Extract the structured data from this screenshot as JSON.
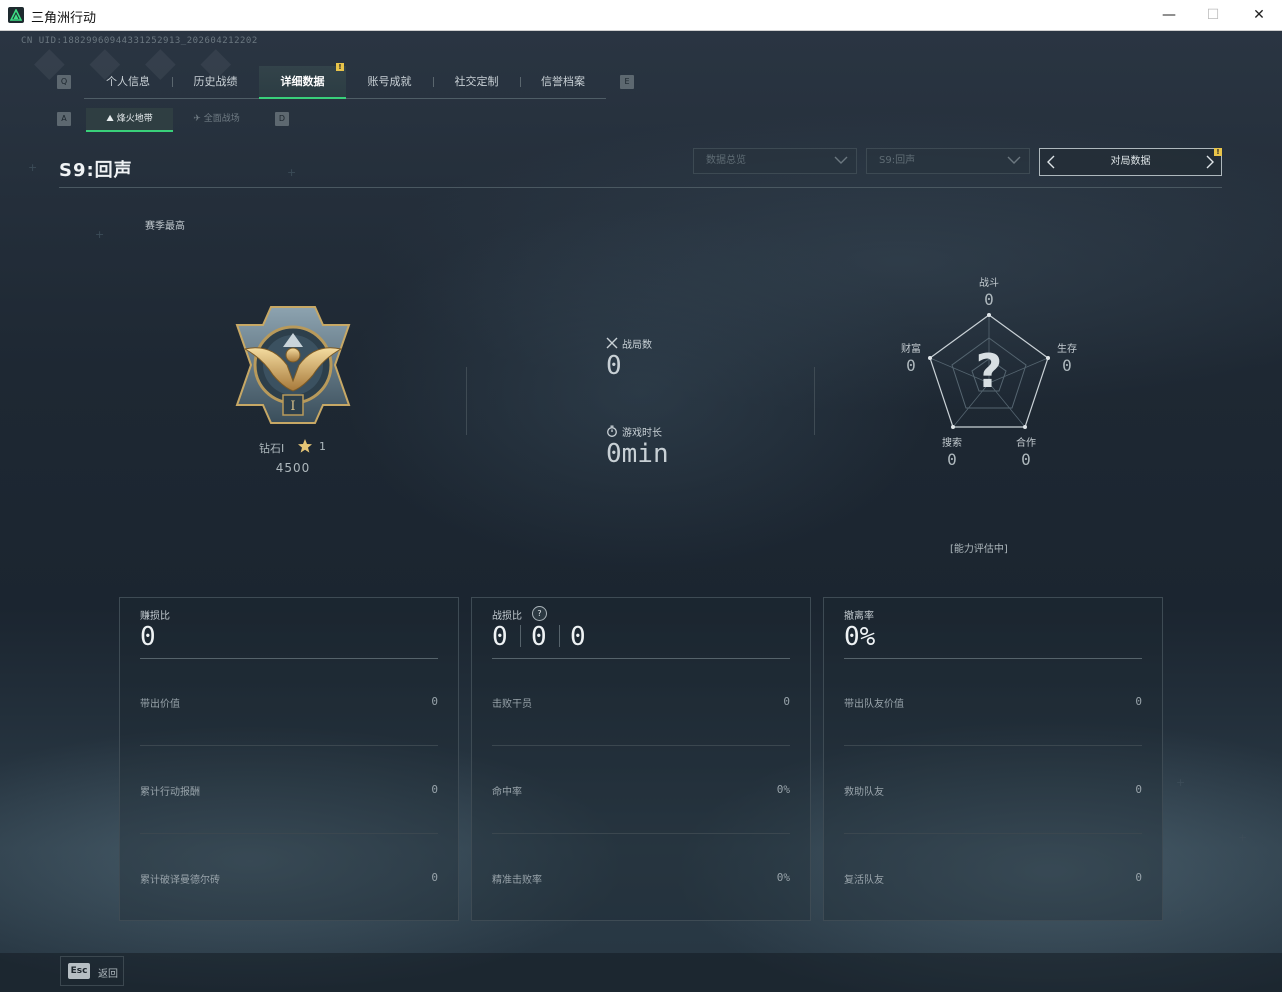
{
  "window": {
    "title": "三角洲行动",
    "controls": {
      "minimize": "—",
      "maximize": "☐",
      "close": "✕"
    }
  },
  "header": {
    "uid": "CN UID:18829960944331252913_202604212202",
    "tabs_key_left": "Q",
    "tabs_key_right": "E",
    "tabs": [
      {
        "label": "个人信息",
        "active": false
      },
      {
        "label": "历史战绩",
        "active": false
      },
      {
        "label": "详细数据",
        "active": true,
        "alert": "!"
      },
      {
        "label": "账号成就",
        "active": false
      },
      {
        "label": "社交定制",
        "active": false
      },
      {
        "label": "信誉档案",
        "active": false
      }
    ],
    "subtabs_key_left": "A",
    "subtabs_key_right": "D",
    "subtabs": [
      {
        "label": "烽火地带",
        "active": true
      },
      {
        "label": "全面战场",
        "active": false
      }
    ]
  },
  "section": {
    "title": "S9:回声",
    "dropdowns": [
      {
        "value": "数据总览"
      },
      {
        "value": "S9:回声"
      }
    ],
    "match_data": {
      "label": "对局数据",
      "alert": "!"
    }
  },
  "rank": {
    "season_best_label": "赛季最高",
    "name": "钻石I",
    "stars": "1",
    "score": "4500"
  },
  "summary": {
    "matches_label": "战局数",
    "matches_value": "0",
    "playtime_label": "游戏时长",
    "playtime_value": "0min"
  },
  "radar": {
    "placeholder": "?",
    "axes": [
      {
        "label": "战斗",
        "value": "0"
      },
      {
        "label": "生存",
        "value": "0"
      },
      {
        "label": "合作",
        "value": "0"
      },
      {
        "label": "搜索",
        "value": "0"
      },
      {
        "label": "财富",
        "value": "0"
      }
    ],
    "status": "[能力评估中]"
  },
  "panels": [
    {
      "head_label": "赚损比",
      "head_value": "0",
      "rows": [
        {
          "label": "带出价值",
          "value": "0"
        },
        {
          "label": "累计行动报酬",
          "value": "0"
        },
        {
          "label": "累计破译曼德尔砖",
          "value": "0"
        }
      ]
    },
    {
      "head_label": "战损比",
      "help": "?",
      "head_values": [
        "0",
        "0",
        "0"
      ],
      "rows": [
        {
          "label": "击败干员",
          "value": "0"
        },
        {
          "label": "命中率",
          "value": "0%"
        },
        {
          "label": "精准击败率",
          "value": "0%"
        }
      ]
    },
    {
      "head_label": "撤离率",
      "head_value": "0%",
      "rows": [
        {
          "label": "带出队友价值",
          "value": "0"
        },
        {
          "label": "救助队友",
          "value": "0"
        },
        {
          "label": "复活队友",
          "value": "0"
        }
      ]
    }
  ],
  "footer": {
    "esc_key": "Esc",
    "back_label": "返回"
  },
  "colors": {
    "accent": "#39d07a",
    "alert": "#e8c44a",
    "background": "#1c2631"
  }
}
